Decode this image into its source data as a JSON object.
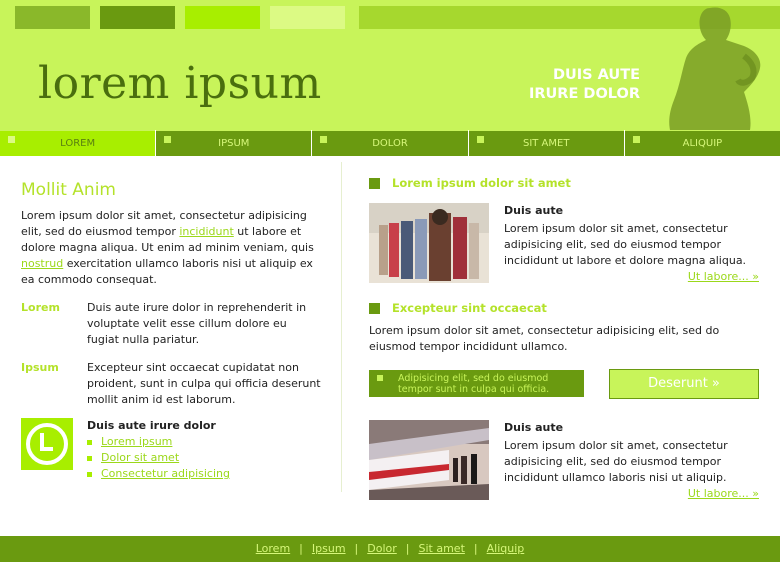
{
  "header": {
    "logo": "lorem ipsum",
    "tagline_line1": "DUIS AUTE",
    "tagline_line2": "IRURE DOLOR"
  },
  "nav": {
    "items": [
      {
        "label": "LOREM",
        "active": true
      },
      {
        "label": "IPSUM"
      },
      {
        "label": "DOLOR"
      },
      {
        "label": "SIT AMET"
      },
      {
        "label": "ALIQUIP"
      }
    ]
  },
  "left": {
    "title": "Mollit Anim",
    "para_part1": "Lorem ipsum dolor sit amet, consectetur adipisicing elit, sed do eiusmod tempor ",
    "para_link1": "incididunt",
    "para_part2": " ut labore et dolore magna aliqua. Ut enim ad minim veniam, quis ",
    "para_link2": "nostrud",
    "para_part3": " exercitation ullamco laboris nisi ut aliquip ex ea commodo consequat.",
    "defs": [
      {
        "term": "Lorem",
        "text": "Duis aute irure dolor in reprehenderit in voluptate velit esse cillum dolore eu fugiat nulla pariatur."
      },
      {
        "term": "Ipsum",
        "text": "Excepteur sint occaecat cupidatat non proident, sunt in culpa qui officia deserunt mollit anim id est laborum."
      }
    ],
    "clock_title": "Duis aute irure dolor",
    "links": [
      "Lorem ipsum",
      "Dolor sit amet",
      "Consectetur adipisicing"
    ]
  },
  "right": {
    "section1_title": "Lorem ipsum dolor sit amet",
    "story1": {
      "title": "Duis aute",
      "body": "Lorem ipsum dolor sit amet, consectetur adipisicing elit, sed do eiusmod tempor incididunt ut labore et dolore magna aliqua."
    },
    "more_label": "Ut labore... »",
    "section2_title": "Excepteur sint occaecat",
    "section2_body": "Lorem ipsum dolor sit amet, consectetur adipisicing elit, sed do eiusmod tempor incididunt ullamco.",
    "highlight_line1": "Adipisicing elit, sed do eiusmod",
    "highlight_line2": "tempor sunt in culpa qui officia.",
    "button_label": "Deserunt »",
    "story2": {
      "title": "Duis aute",
      "body": "Lorem ipsum dolor sit amet, consectetur adipisicing elit, sed do eiusmod tempor incididunt ullamco laboris nisi ut aliquip."
    }
  },
  "footer": {
    "links": [
      "Lorem",
      "Ipsum",
      "Dolor",
      "Sit amet",
      "Aliquip"
    ],
    "separator": "|"
  },
  "colors": {
    "header_bg": "#c8f45a",
    "dark_green": "#6a9a10",
    "bright_green": "#a8ee00",
    "accent_text": "#b4e22a"
  }
}
